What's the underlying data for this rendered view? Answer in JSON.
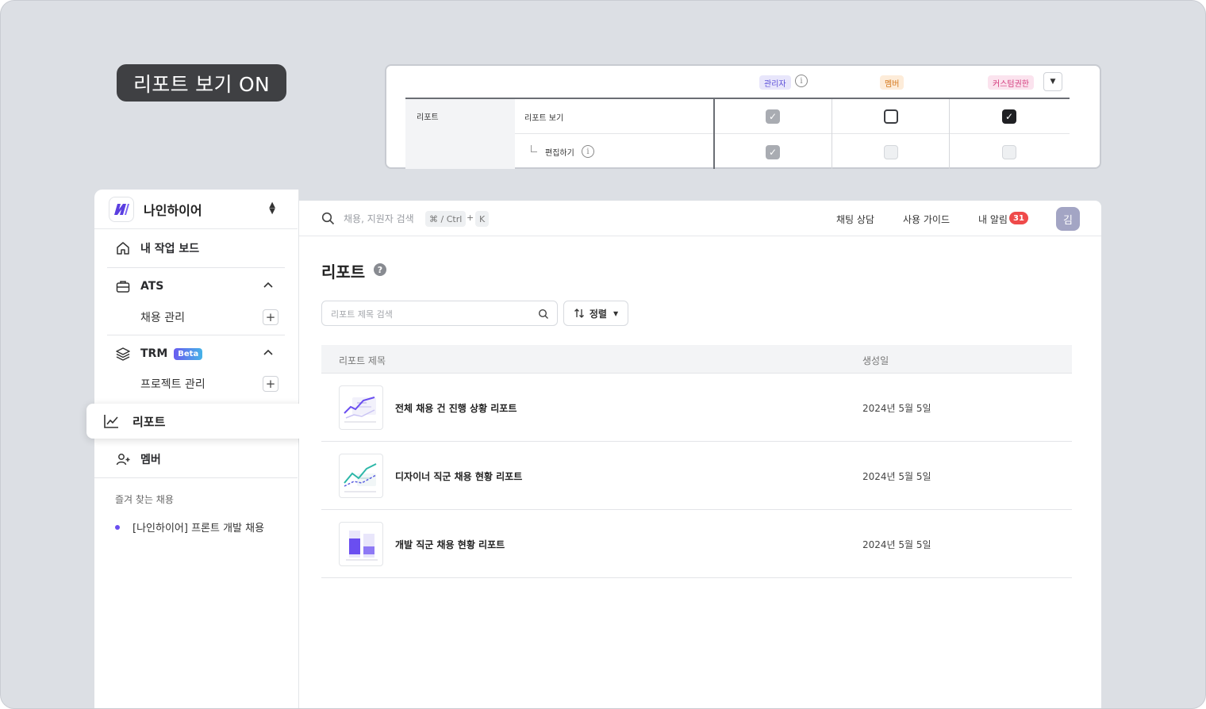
{
  "tag_pill": "리포트 보기 ON",
  "permissions": {
    "roles": [
      "관리자",
      "멤버",
      "커스텀권한"
    ],
    "category": "리포트",
    "rows": [
      {
        "label": "리포트 보기",
        "admin": "checked-disabled",
        "member": "unchecked",
        "custom": "checked"
      },
      {
        "label": "편집하기",
        "admin": "checked-disabled",
        "member": "disabled",
        "custom": "disabled"
      }
    ]
  },
  "sidebar": {
    "workspace": "나인하이어",
    "items": [
      {
        "label": "내 작업 보드",
        "icon": "home-icon"
      },
      {
        "label": "ATS",
        "icon": "briefcase-icon",
        "expanded": true
      },
      {
        "label": "채용 관리"
      },
      {
        "label": "TRM",
        "icon": "layers-icon",
        "badge": "Beta",
        "expanded": true
      },
      {
        "label": "프로젝트 관리"
      },
      {
        "label": "리포트",
        "icon": "chart-icon",
        "active": true
      },
      {
        "label": "멤버",
        "icon": "user-add-icon"
      }
    ],
    "favorites_title": "즐겨 찾는 채용",
    "favorites": [
      "[나인하이어] 프론트 개발 채용"
    ]
  },
  "topbar": {
    "search_placeholder": "채용, 지원자 검색",
    "shortcut_key1": "⌘ / Ctrl",
    "shortcut_plus": "+",
    "shortcut_key2": "K",
    "chat": "채팅 상담",
    "guide": "사용 가이드",
    "notifications": "내 알림",
    "notification_count": "31",
    "avatar": "김"
  },
  "main": {
    "title": "리포트",
    "search_placeholder": "리포트 제목 검색",
    "sort_label": "정렬",
    "columns": [
      "리포트 제목",
      "생성일"
    ],
    "reports": [
      {
        "title": "전체 채용 건 진행 상황 리포트",
        "date": "2024년 5월 5일"
      },
      {
        "title": "디자이너 직군 채용 현황 리포트",
        "date": "2024년 5월 5일"
      },
      {
        "title": "개발 직군 채용 현황 리포트",
        "date": "2024년 5월 5일"
      }
    ]
  },
  "colors": {
    "accent": "#6a4ef0",
    "badge_red": "#ef4a4a",
    "dark": "#1f2023"
  }
}
